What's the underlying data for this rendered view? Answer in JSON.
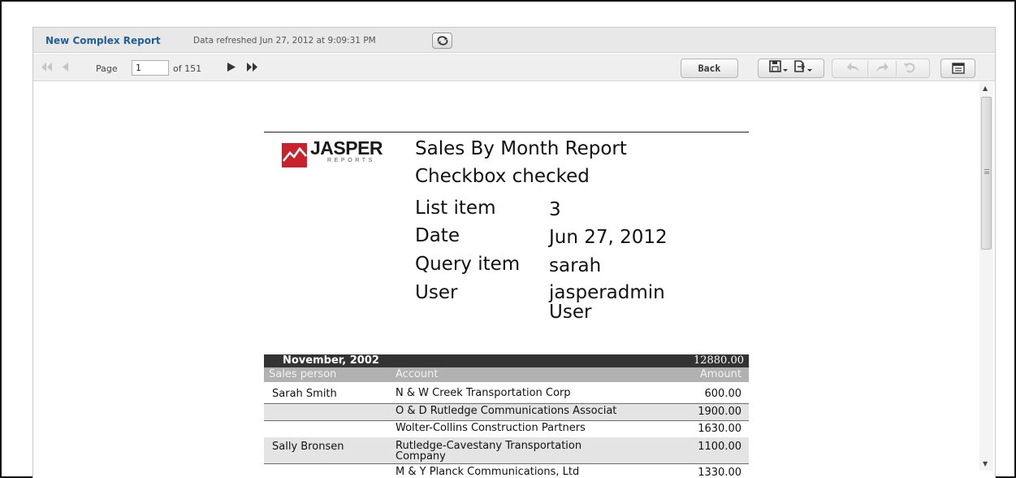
{
  "header": {
    "report_title": "New Complex Report",
    "refreshed_text": "Data refreshed Jun 27, 2012 at 9:09:31 PM"
  },
  "pager": {
    "page_label": "Page",
    "current_page": "1",
    "of_label": "of 151"
  },
  "toolbar": {
    "back_label": "Back"
  },
  "logo": {
    "word": "JASPER",
    "sub": "REPORTS"
  },
  "report": {
    "title": "Sales By Month Report",
    "subtitle": "Checkbox checked",
    "params": [
      {
        "label": "List item",
        "value": "3"
      },
      {
        "label": "Date",
        "value": "Jun 27, 2012"
      },
      {
        "label": "Query item",
        "value": "sarah"
      },
      {
        "label": "User",
        "value": "jasperadmin\nUser"
      }
    ],
    "group": {
      "month": "November, 2002",
      "total": "12880.00"
    },
    "columns": {
      "sales_person": "Sales person",
      "account": "Account",
      "amount": "Amount"
    },
    "rows": [
      {
        "person": "Sarah Smith",
        "account": "N & W Creek Transportation Corp",
        "amount": "600.00"
      },
      {
        "person": "",
        "account": "O & D Rutledge Communications Associat",
        "amount": "1900.00"
      },
      {
        "person": "",
        "account": "Wolter-Collins Construction Partners",
        "amount": "1630.00"
      },
      {
        "person": "Sally Bronsen",
        "account": "Rutledge-Cavestany Transportation Company",
        "amount": "1100.00"
      },
      {
        "person": "",
        "account": "M & Y Planck Communications, Ltd",
        "amount": "1330.00"
      }
    ]
  },
  "colors": {
    "title_link": "#1f5f96",
    "logo_red": "#c8232c",
    "group_bar": "#333333",
    "column_header": "#b1b1b1",
    "row_shade": "#e4e4e4"
  }
}
